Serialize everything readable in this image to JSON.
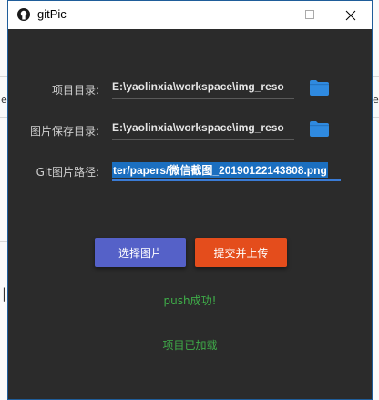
{
  "window": {
    "title": "gitPic",
    "minimize_icon": "minimize-icon",
    "maximize_icon": "maximize-icon",
    "close_icon": "close-icon"
  },
  "form": {
    "project_dir_label": "项目目录:",
    "project_dir_value": "E:\\yaolinxia\\workspace\\img_reso",
    "save_dir_label": "图片保存目录:",
    "save_dir_value": "E:\\yaolinxia\\workspace\\img_reso",
    "git_path_label": "Git图片路径:",
    "git_path_value": "ter/papers/微信截图_20190122143808.png",
    "folder_icon": "folder-icon",
    "folder_color": "#2f8ae0"
  },
  "actions": {
    "select_label": "选择图片",
    "select_color": "#5561c8",
    "upload_label": "提交并上传",
    "upload_color": "#e44d1c"
  },
  "status": {
    "push_message": "push成功!",
    "loaded_message": "项目已加载",
    "color": "#3fae49"
  }
}
